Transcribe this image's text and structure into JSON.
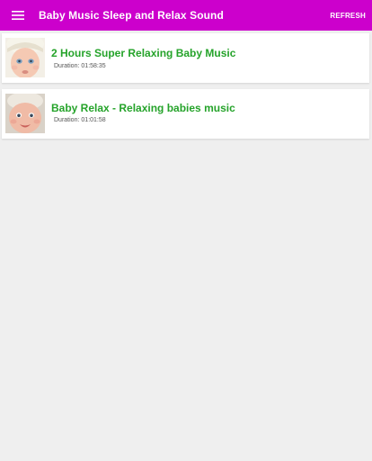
{
  "appbar": {
    "title": "Baby Music Sleep and Relax Sound",
    "refresh_label": "REFRESH",
    "menu_icon": "hamburger-menu-icon",
    "background_color": "#cc00cc"
  },
  "videos": [
    {
      "title": "2 Hours Super Relaxing Baby Music",
      "duration_label": "Duration:",
      "duration": "01:58:35"
    },
    {
      "title": "Baby Relax - Relaxing babies music",
      "duration_label": "Duration:",
      "duration": "01:01:58"
    }
  ],
  "colors": {
    "title_green": "#25a32a",
    "background": "#efefef"
  }
}
